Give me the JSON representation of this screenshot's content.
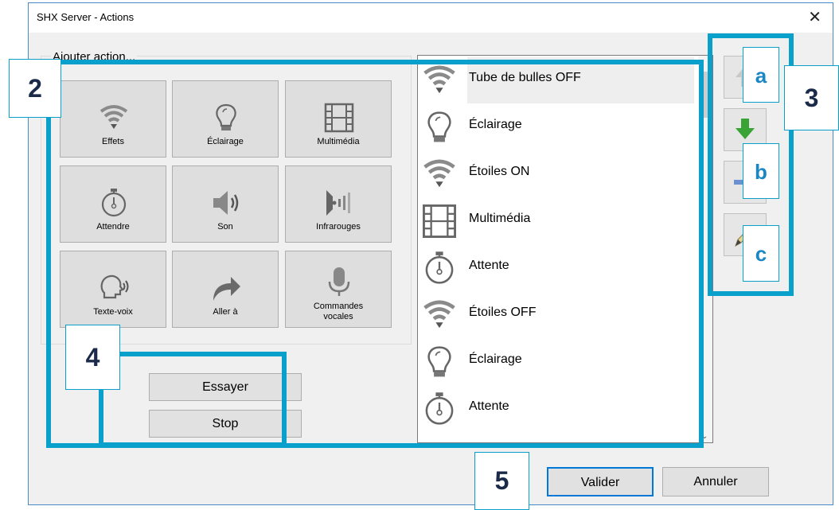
{
  "window": {
    "title": "SHX Server - Actions",
    "close_glyph": "✕"
  },
  "add_action": {
    "label": "Ajouter action...",
    "tiles": [
      {
        "label": "Effets",
        "icon": "wifi-icon"
      },
      {
        "label": "Éclairage",
        "icon": "bulb-icon"
      },
      {
        "label": "Multimédia",
        "icon": "film-icon"
      },
      {
        "label": "Attendre",
        "icon": "stopwatch-icon"
      },
      {
        "label": "Son",
        "icon": "speaker-icon"
      },
      {
        "label": "Infrarouges",
        "icon": "infrared-icon"
      },
      {
        "label": "Texte-voix",
        "icon": "speech-head-icon"
      },
      {
        "label": "Aller à",
        "icon": "redo-arrow-icon"
      },
      {
        "label": "Commandes vocales",
        "icon": "microphone-icon"
      }
    ]
  },
  "buttons": {
    "try": "Essayer",
    "stop": "Stop",
    "validate": "Valider",
    "cancel": "Annuler"
  },
  "action_list": [
    {
      "label": "Tube de bulles OFF",
      "icon": "wifi-icon",
      "selected": true
    },
    {
      "label": "Éclairage",
      "icon": "bulb-icon"
    },
    {
      "label": "Étoiles ON",
      "icon": "wifi-icon"
    },
    {
      "label": "Multimédia",
      "icon": "film-icon"
    },
    {
      "label": "Attente",
      "icon": "stopwatch-icon"
    },
    {
      "label": "Étoiles OFF",
      "icon": "wifi-icon"
    },
    {
      "label": "Éclairage",
      "icon": "bulb-icon"
    },
    {
      "label": "Attente",
      "icon": "stopwatch-icon"
    }
  ],
  "side_buttons": [
    {
      "icon": "arrow-up-icon",
      "enabled": false
    },
    {
      "icon": "arrow-down-icon",
      "enabled": true
    },
    {
      "icon": "minus-icon",
      "enabled": true
    },
    {
      "icon": "pencil-icon",
      "enabled": true
    }
  ],
  "annotations": {
    "n2": "2",
    "n3": "3",
    "n4": "4",
    "n5": "5",
    "a": "a",
    "b": "b",
    "c": "c"
  },
  "colors": {
    "callout": "#0aa0cc",
    "badge_text": "#1c2a4a",
    "letter_text": "#1a87c4"
  }
}
